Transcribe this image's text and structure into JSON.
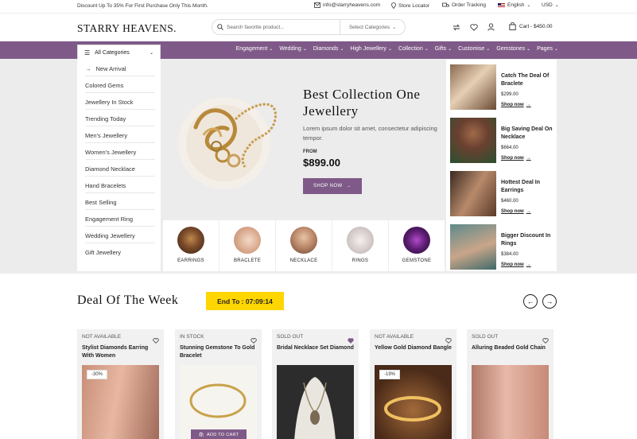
{
  "topbar": {
    "promo": "Discount Up To 35% For First Purchase Only This Month.",
    "email": "info@starryheavens.com",
    "store_locator": "Store Locator",
    "order_tracking": "Order Tracking",
    "language": "English",
    "currency": "USD"
  },
  "header": {
    "logo": "STARRY HEAVENS.",
    "search_placeholder": "Search favorite product...",
    "category_select": "Select Categories",
    "cart": "Cart - $450.00"
  },
  "nav": {
    "all_categories": "All Categories",
    "items": [
      "Engagement",
      "Wedding",
      "Diamonds",
      "High Jewellery",
      "Collection",
      "Gifts",
      "Customise",
      "Gemstones",
      "Pages"
    ]
  },
  "sidebar": {
    "items": [
      "New Arrival",
      "Colored Gems",
      "Jewellery In Stock",
      "Trending Today",
      "Men's Jewellery",
      "Women's Jewellery",
      "Diamond Necklace",
      "Hand Bracelets",
      "Best Selling",
      "Engagement Ring",
      "Wedding Jewellery",
      "Gift Jewellery"
    ]
  },
  "banner": {
    "title": "Best Collection One Jewellery",
    "desc": "Lorem ipsum dolor sit amet, consectetur adipiscing tempor.",
    "from": "FROM",
    "price": "$899.00",
    "button": "SHOP NOW"
  },
  "categories": [
    "EARRINGS",
    "BRACLETE",
    "NECKLACE",
    "RINGS",
    "GEMSTONE"
  ],
  "side_deals": [
    {
      "title": "Catch The Deal Of Braclete",
      "price": "$299.00",
      "link": "Shop now"
    },
    {
      "title": "Big Saving Deal On Necklace",
      "price": "$664.00",
      "link": "Shop now"
    },
    {
      "title": "Hottest Deal In Earrings",
      "price": "$460.00",
      "link": "Shop now"
    },
    {
      "title": "Bigger Discount In Rings",
      "price": "$384.00",
      "link": "Shop now"
    }
  ],
  "deal_week": {
    "title": "Deal Of The Week",
    "timer": "End To : 07:09:14"
  },
  "products": [
    {
      "status": "NOT AVAILABLE",
      "name": "Stylist Diamonds Earring With Women",
      "discount": "-30%"
    },
    {
      "status": "IN STOCK",
      "name": "Stunning Gemstone To Gold Bracelet",
      "add_to_cart": "ADD TO CART"
    },
    {
      "status": "SOLD OUT",
      "name": "Bridal Necklace Set Diamond"
    },
    {
      "status": "NOT AVAILABLE",
      "name": "Yellow Gold Diamond Bangle",
      "discount": "-19%"
    },
    {
      "status": "SOLD OUT",
      "name": "Alluring Beaded Gold Chain"
    }
  ],
  "colors": {
    "accent": "#7f5a88",
    "timer": "#ffd600",
    "hero_bg": "#ececec"
  }
}
